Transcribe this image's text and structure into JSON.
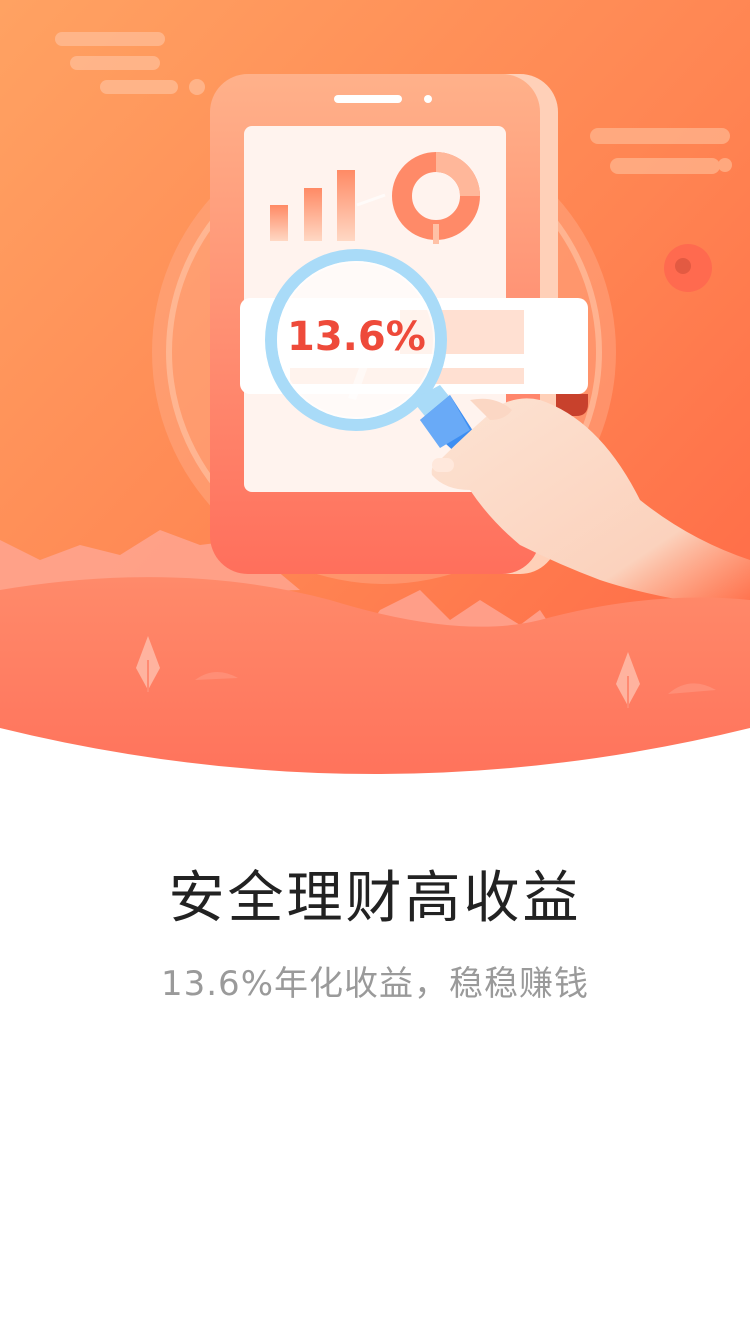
{
  "banner": {
    "rate_label": "13.6%",
    "icons": [
      "phone-icon",
      "bar-chart-icon",
      "donut-chart-icon",
      "magnifier-icon",
      "hand-icon",
      "cloud-icon",
      "coin-icon",
      "tree-icon"
    ]
  },
  "intro": {
    "title": "安全理财高收益",
    "subtitle": "13.6%年化收益，稳稳赚钱"
  },
  "colors": {
    "primary": "#ff6b4f",
    "gradient_start": "#ff9c60",
    "gradient_end": "#ff6248",
    "title": "#222222",
    "subtitle": "#9a9a9a"
  }
}
